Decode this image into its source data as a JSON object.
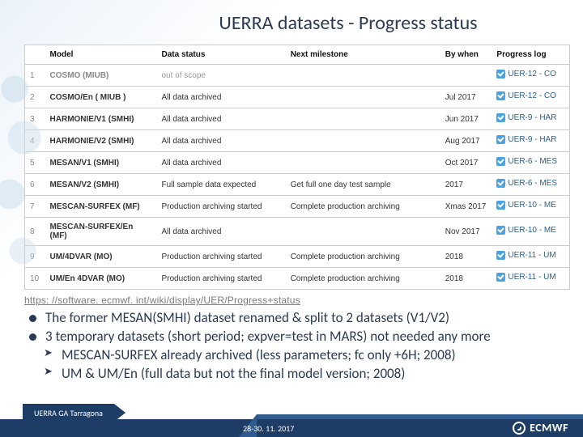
{
  "title": "UERRA datasets - Progress status",
  "table": {
    "headers": [
      "",
      "Model",
      "Data status",
      "Next milestone",
      "By when",
      "Progress log"
    ],
    "rows": [
      {
        "n": "1",
        "model": "COSMO (MIUB)",
        "status": "out of scope",
        "next": "",
        "when": "",
        "log": "UER-12 - CO",
        "oos": true
      },
      {
        "n": "2",
        "model": "COSMO/En ( MIUB )",
        "status": "All data archived",
        "next": "",
        "when": "Jul 2017",
        "log": "UER-12 - CO"
      },
      {
        "n": "3",
        "model": "HARMONIE/V1 (SMHI)",
        "status": "All data archived",
        "next": "",
        "when": "Jun 2017",
        "log": "UER-9 - HAR"
      },
      {
        "n": "4",
        "model": "HARMONIE/V2 (SMHI)",
        "status": "All data archived",
        "next": "",
        "when": "Aug 2017",
        "log": "UER-9 - HAR"
      },
      {
        "n": "5",
        "model": "MESAN/V1 (SMHI)",
        "status": "All data archived",
        "next": "",
        "when": "Oct 2017",
        "log": "UER-6 - MES"
      },
      {
        "n": "6",
        "model": "MESAN/V2 (SMHI)",
        "status": "Full sample data expected",
        "next": "Get full one day test sample",
        "when": "2017",
        "log": "UER-6 - MES"
      },
      {
        "n": "7",
        "model": "MESCAN-SURFEX (MF)",
        "status": "Production archiving started",
        "next": "Complete production archiving",
        "when": "Xmas 2017",
        "log": "UER-10 - ME"
      },
      {
        "n": "8",
        "model": "MESCAN-SURFEX/En (MF)",
        "status": "All data archived",
        "next": "",
        "when": "Nov 2017",
        "log": "UER-10 - ME"
      },
      {
        "n": "9",
        "model": "UM/4DVAR (MO)",
        "status": "Production archiving started",
        "next": "Complete production archiving",
        "when": "2018",
        "log": "UER-11 - UM"
      },
      {
        "n": "10",
        "model": "UM/En 4DVAR (MO)",
        "status": "Production archiving started",
        "next": "Complete production archiving",
        "when": "2018",
        "log": "UER-11 - UM"
      }
    ]
  },
  "url": "https: //software. ecmwf. int/wiki/display/UER/Progress+status",
  "bullets": {
    "b1": "The former MESAN(SMHI) dataset renamed & split to 2 datasets (V1/V2)",
    "b2": "3 temporary datasets (short period; expver=test in MARS) not needed any more",
    "s1": "MESCAN-SURFEX already archived (less parameters; fc only +6H; 2008)",
    "s2": "UM & UM/En (full data but not the final model version; 2008)"
  },
  "footer": {
    "left": "UERRA GA Tarragona",
    "date": "28-30. 11. 2017",
    "brand": "ECMWF"
  }
}
